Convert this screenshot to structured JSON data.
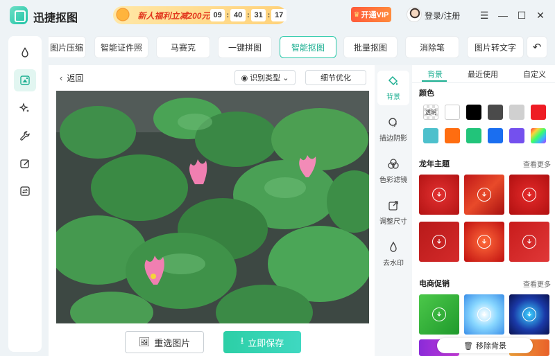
{
  "app": {
    "title": "迅捷抠图",
    "promo": {
      "text": "新人福利立减200元",
      "hours": "09",
      "minutes": "40",
      "seconds": "31",
      "frames": "17"
    },
    "vip_label": "开通VIP",
    "login_label": "登录/注册"
  },
  "window_controls": {
    "menu": "☰",
    "minimize": "—",
    "maximize": "☐",
    "close": "✕"
  },
  "sidebar": {
    "items": [
      "shape-tool",
      "cutout",
      "magic",
      "wrench",
      "edit",
      "convert"
    ]
  },
  "tabs": [
    {
      "label": "图片压缩"
    },
    {
      "label": "智能证件照"
    },
    {
      "label": "马赛克"
    },
    {
      "label": "一键拼图"
    },
    {
      "label": "智能抠图"
    },
    {
      "label": "批量抠图"
    },
    {
      "label": "消除笔"
    },
    {
      "label": "图片转文字"
    }
  ],
  "canvas": {
    "back_label": "返回",
    "recognize_type": "识别类型",
    "detail_optimize": "细节优化",
    "reselect_label": "重选图片",
    "save_label": "立即保存"
  },
  "tools": [
    {
      "label": "背景"
    },
    {
      "label": "描边阴影"
    },
    {
      "label": "色彩滤镜"
    },
    {
      "label": "调整尺寸"
    },
    {
      "label": "去水印"
    }
  ],
  "right_panel": {
    "tabs": [
      {
        "label": "背景"
      },
      {
        "label": "最近使用"
      },
      {
        "label": "自定义"
      }
    ],
    "colors_title": "颜色",
    "transparent_label": "透明",
    "colors": [
      "#ffffff",
      "#000000",
      "#4a4a4a",
      "#d0d0d0",
      "#ee1c24",
      "#4dc0cc",
      "#ff6d10",
      "#22c47a",
      "#1a6ef0",
      "#7450ee"
    ],
    "dragon_title": "龙年主题",
    "dragon_more": "查看更多",
    "ecommerce_title": "电商促销",
    "ecommerce_more": "查看更多",
    "remove_bg_label": "移除背景"
  }
}
